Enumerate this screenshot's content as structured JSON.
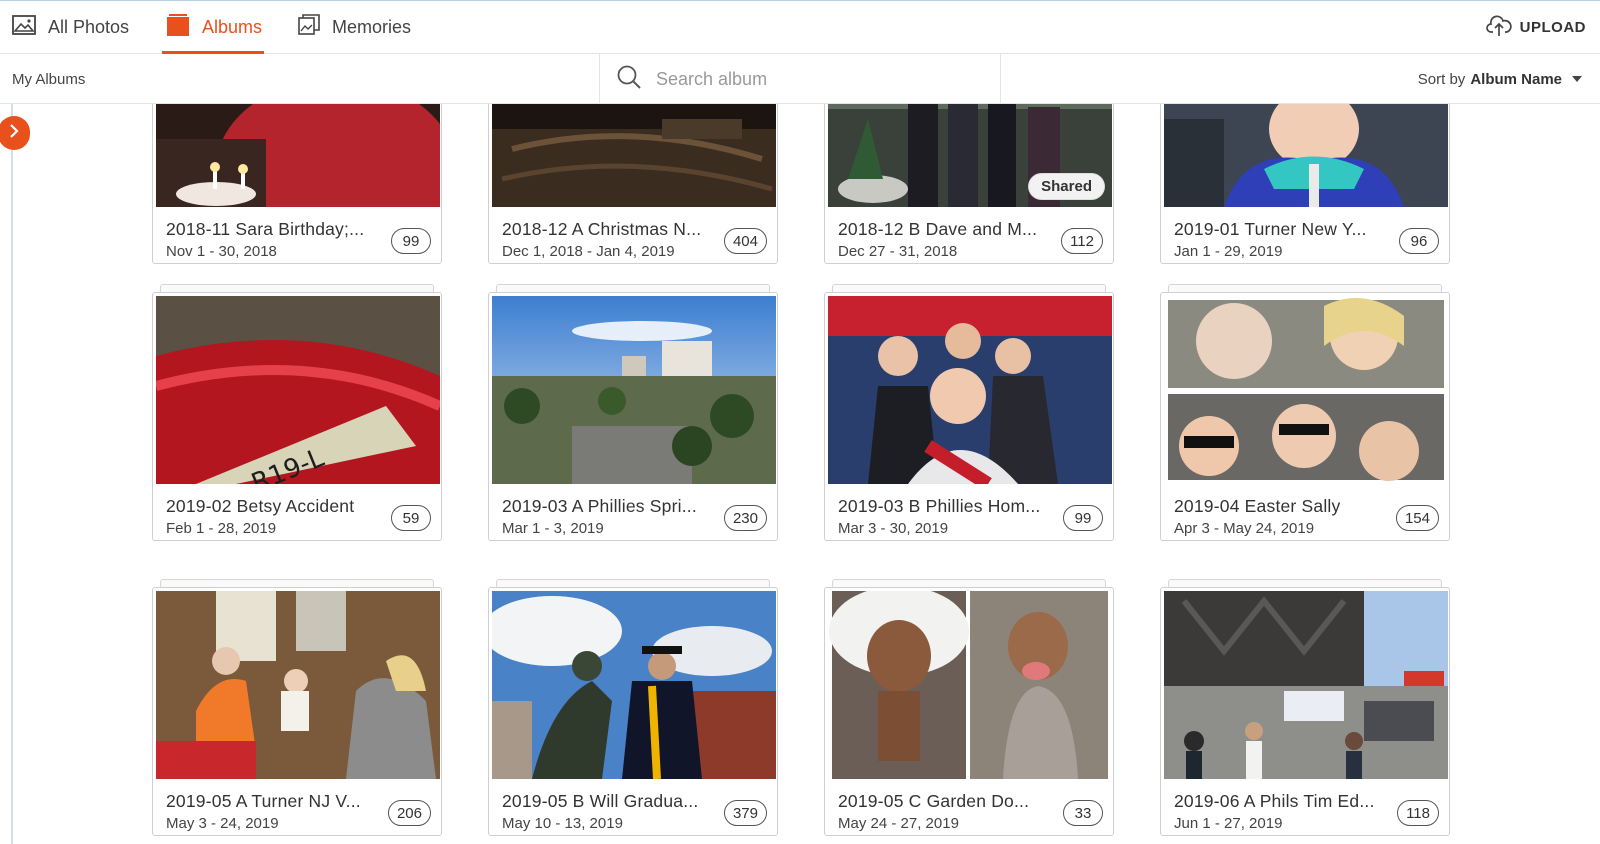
{
  "nav": {
    "tabs": [
      {
        "label": "All Photos",
        "icon": "image-icon"
      },
      {
        "label": "Albums",
        "icon": "album-icon",
        "active": true
      },
      {
        "label": "Memories",
        "icon": "memories-icon"
      }
    ],
    "upload_label": "UPLOAD"
  },
  "subbar": {
    "my_albums": "My Albums",
    "search_placeholder": "Search album",
    "sort_prefix": "Sort by",
    "sort_value": "Album Name"
  },
  "colors": {
    "accent": "#e8511c"
  },
  "albums": [
    {
      "title": "2018-11 Sara Birthday;...",
      "dates": "Nov 1 - 30, 2018",
      "count": "99"
    },
    {
      "title": "2018-12 A Christmas N...",
      "dates": "Dec 1, 2018 - Jan 4, 2019",
      "count": "404"
    },
    {
      "title": "2018-12 B Dave and M...",
      "dates": "Dec 27 - 31, 2018",
      "count": "112",
      "badge": "Shared"
    },
    {
      "title": "2019-01 Turner New Y...",
      "dates": "Jan 1 - 29, 2019",
      "count": "96"
    },
    {
      "title": "2019-02 Betsy Accident",
      "dates": "Feb 1 - 28, 2019",
      "count": "59"
    },
    {
      "title": "2019-03 A Phillies Spri...",
      "dates": "Mar 1 - 3, 2019",
      "count": "230"
    },
    {
      "title": "2019-03 B Phillies Hom...",
      "dates": "Mar 3 - 30, 2019",
      "count": "99"
    },
    {
      "title": "2019-04 Easter Sally",
      "dates": "Apr 3 - May 24, 2019",
      "count": "154"
    },
    {
      "title": "2019-05 A Turner NJ V...",
      "dates": "May 3 - 24, 2019",
      "count": "206"
    },
    {
      "title": "2019-05 B Will Gradua...",
      "dates": "May 10 - 13, 2019",
      "count": "379"
    },
    {
      "title": "2019-05 C Garden Do...",
      "dates": "May 24 - 27, 2019",
      "count": "33"
    },
    {
      "title": "2019-06 A Phils Tim Ed...",
      "dates": "Jun 1 - 27, 2019",
      "count": "118"
    }
  ]
}
